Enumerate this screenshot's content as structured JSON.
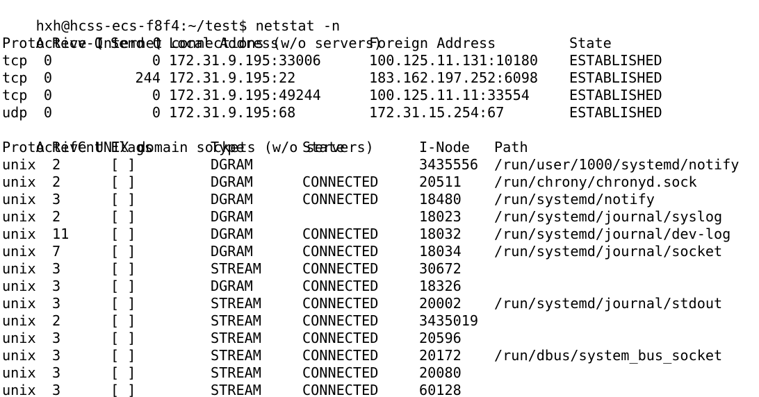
{
  "prompt": {
    "text": "hxh@hcss-ecs-f8f4:~/test$ netstat -n"
  },
  "inet": {
    "heading": "Active Internet connections (w/o servers)",
    "headers": {
      "proto": "Proto",
      "recvq": "Recv-Q",
      "sendq": "Send-Q",
      "local": "Local Address",
      "foreign": "Foreign Address",
      "state": "State"
    },
    "rows": [
      {
        "proto": "tcp",
        "recvq": "0",
        "sendq": "0",
        "local": "172.31.9.195:33006",
        "foreign": "100.125.11.131:10180",
        "state": "ESTABLISHED"
      },
      {
        "proto": "tcp",
        "recvq": "0",
        "sendq": "244",
        "local": "172.31.9.195:22",
        "foreign": "183.162.197.252:6098",
        "state": "ESTABLISHED"
      },
      {
        "proto": "tcp",
        "recvq": "0",
        "sendq": "0",
        "local": "172.31.9.195:49244",
        "foreign": "100.125.11.11:33554",
        "state": "ESTABLISHED"
      },
      {
        "proto": "udp",
        "recvq": "0",
        "sendq": "0",
        "local": "172.31.9.195:68",
        "foreign": "172.31.15.254:67",
        "state": "ESTABLISHED"
      }
    ]
  },
  "unix": {
    "heading": "Active UNIX domain sockets (w/o servers)",
    "headers": {
      "proto": "Proto",
      "refcnt": "RefCnt",
      "flags": "Flags",
      "type": "Type",
      "state": "State",
      "inode": "I-Node",
      "path": "Path"
    },
    "rows": [
      {
        "proto": "unix",
        "refcnt": "2",
        "flags": "[ ]",
        "type": "DGRAM",
        "state": "",
        "inode": "3435556",
        "path": "/run/user/1000/systemd/notify"
      },
      {
        "proto": "unix",
        "refcnt": "2",
        "flags": "[ ]",
        "type": "DGRAM",
        "state": "CONNECTED",
        "inode": "20511",
        "path": "/run/chrony/chronyd.sock"
      },
      {
        "proto": "unix",
        "refcnt": "3",
        "flags": "[ ]",
        "type": "DGRAM",
        "state": "CONNECTED",
        "inode": "18480",
        "path": "/run/systemd/notify"
      },
      {
        "proto": "unix",
        "refcnt": "2",
        "flags": "[ ]",
        "type": "DGRAM",
        "state": "",
        "inode": "18023",
        "path": "/run/systemd/journal/syslog"
      },
      {
        "proto": "unix",
        "refcnt": "11",
        "flags": "[ ]",
        "type": "DGRAM",
        "state": "CONNECTED",
        "inode": "18032",
        "path": "/run/systemd/journal/dev-log"
      },
      {
        "proto": "unix",
        "refcnt": "7",
        "flags": "[ ]",
        "type": "DGRAM",
        "state": "CONNECTED",
        "inode": "18034",
        "path": "/run/systemd/journal/socket"
      },
      {
        "proto": "unix",
        "refcnt": "3",
        "flags": "[ ]",
        "type": "STREAM",
        "state": "CONNECTED",
        "inode": "30672",
        "path": ""
      },
      {
        "proto": "unix",
        "refcnt": "3",
        "flags": "[ ]",
        "type": "DGRAM",
        "state": "CONNECTED",
        "inode": "18326",
        "path": ""
      },
      {
        "proto": "unix",
        "refcnt": "3",
        "flags": "[ ]",
        "type": "STREAM",
        "state": "CONNECTED",
        "inode": "20002",
        "path": "/run/systemd/journal/stdout"
      },
      {
        "proto": "unix",
        "refcnt": "2",
        "flags": "[ ]",
        "type": "STREAM",
        "state": "CONNECTED",
        "inode": "3435019",
        "path": ""
      },
      {
        "proto": "unix",
        "refcnt": "3",
        "flags": "[ ]",
        "type": "STREAM",
        "state": "CONNECTED",
        "inode": "20596",
        "path": ""
      },
      {
        "proto": "unix",
        "refcnt": "3",
        "flags": "[ ]",
        "type": "STREAM",
        "state": "CONNECTED",
        "inode": "20172",
        "path": "/run/dbus/system_bus_socket"
      },
      {
        "proto": "unix",
        "refcnt": "3",
        "flags": "[ ]",
        "type": "STREAM",
        "state": "CONNECTED",
        "inode": "20080",
        "path": ""
      },
      {
        "proto": "unix",
        "refcnt": "3",
        "flags": "[ ]",
        "type": "STREAM",
        "state": "CONNECTED",
        "inode": "60128",
        "path": ""
      }
    ]
  },
  "colors": {
    "background": "#ffffff",
    "text": "#000000"
  }
}
